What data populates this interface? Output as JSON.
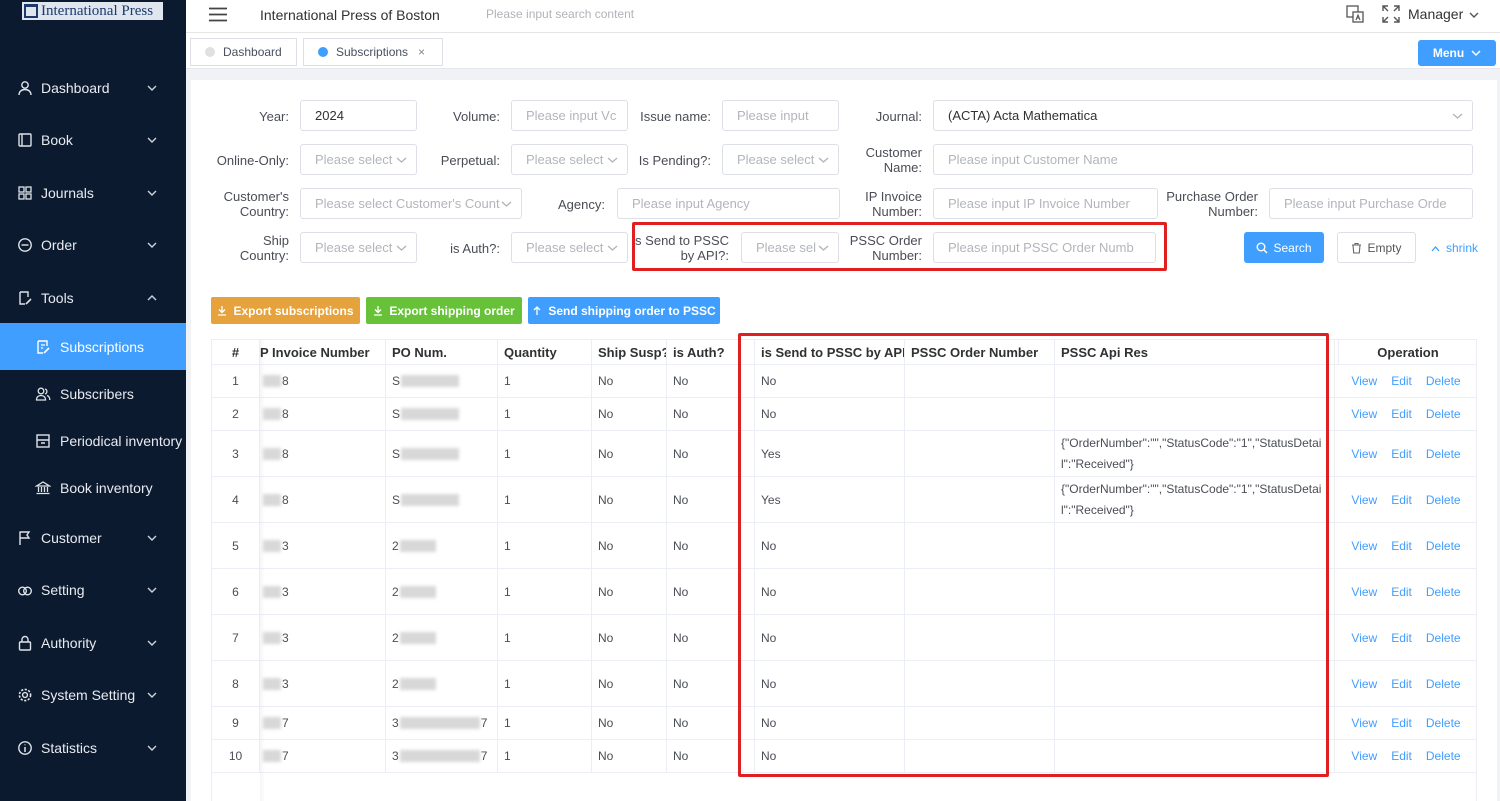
{
  "app": {
    "logo_text": "International Press",
    "header_title": "International Press of Boston",
    "search_placeholder": "Please input search content",
    "user_label": "Manager"
  },
  "sidebar": {
    "items": [
      {
        "label": "Dashboard",
        "icon": "user-icon"
      },
      {
        "label": "Book",
        "icon": "book-icon"
      },
      {
        "label": "Journals",
        "icon": "grid-icon"
      },
      {
        "label": "Order",
        "icon": "order-icon"
      },
      {
        "label": "Tools",
        "icon": "edit-icon"
      },
      {
        "label": "Customer",
        "icon": "flag-icon"
      },
      {
        "label": "Setting",
        "icon": "link-icon"
      },
      {
        "label": "Authority",
        "icon": "lock-icon"
      },
      {
        "label": "System Setting",
        "icon": "gear-icon"
      },
      {
        "label": "Statistics",
        "icon": "info-icon"
      }
    ],
    "tools_sub": [
      {
        "label": "Subscriptions",
        "icon": "edit-doc-icon"
      },
      {
        "label": "Subscribers",
        "icon": "users-icon"
      },
      {
        "label": "Periodical inventory",
        "icon": "inventory-icon"
      },
      {
        "label": "Book inventory",
        "icon": "bank-icon"
      }
    ]
  },
  "tabs": [
    {
      "label": "Dashboard",
      "dot_color": "#e0e0e0"
    },
    {
      "label": "Subscriptions",
      "dot_color": "#409eff",
      "close": "×"
    }
  ],
  "menu_button": "Menu",
  "filters": {
    "year": {
      "label": "Year:",
      "value": "2024"
    },
    "volume": {
      "label": "Volume:",
      "placeholder": "Please input Vc"
    },
    "issue_name": {
      "label": "Issue name:",
      "placeholder": "Please input"
    },
    "journal": {
      "label": "Journal:",
      "value": "(ACTA) Acta Mathematica"
    },
    "online_only": {
      "label": "Online-Only:",
      "placeholder": "Please select"
    },
    "perpetual": {
      "label": "Perpetual:",
      "placeholder": "Please select"
    },
    "is_pending": {
      "label": "Is Pending?:",
      "placeholder": "Please select"
    },
    "customer_name": {
      "label_line1": "Customer",
      "label_line2": "Name:",
      "placeholder": "Please input Customer Name"
    },
    "customers_country": {
      "label_line1": "Customer's",
      "label_line2": "Country:",
      "placeholder": "Please select Customer's Count"
    },
    "agency": {
      "label": "Agency:",
      "placeholder": "Please input Agency"
    },
    "ip_invoice": {
      "label_line1": "IP Invoice",
      "label_line2": "Number:",
      "placeholder": "Please input IP Invoice Number"
    },
    "purchase_order": {
      "label_line1": "Purchase Order",
      "label_line2": "Number:",
      "placeholder": "Please input Purchase Orde"
    },
    "ship_country": {
      "label_line1": "Ship",
      "label_line2": "Country:",
      "placeholder": "Please select"
    },
    "is_auth": {
      "label": "is Auth?:",
      "placeholder": "Please select"
    },
    "is_send_pssc": {
      "label_line1": "is Send to PSSC",
      "label_line2": "by API?:",
      "placeholder": "Please sel"
    },
    "pssc_order": {
      "label_line1": "PSSC Order",
      "label_line2": "Number:",
      "placeholder": "Please input PSSC Order Numb"
    }
  },
  "buttons": {
    "search": "Search",
    "empty": "Empty",
    "shrink": "shrink",
    "export_subscriptions": "Export subscriptions",
    "export_shipping": "Export shipping order",
    "send_shipping": "Send shipping order to PSSC"
  },
  "colors": {
    "accent": "#409eff",
    "export_orange": "#e6a23c",
    "export_green": "#67c23a",
    "sidebar_bg": "#0b1a2e",
    "highlight_red": "#e02020"
  },
  "table": {
    "columns": [
      "#",
      "P Invoice Number",
      "PO Num.",
      "Quantity",
      "Ship Susp?",
      "is Auth?",
      "is Send to PSSC by API?",
      "PSSC Order Number",
      "PSSC Api Res",
      "Operation"
    ],
    "operations": [
      "View",
      "Edit",
      "Delete"
    ],
    "rows": [
      {
        "n": "1",
        "inv_tail": "8",
        "po_head": "S",
        "po_tail": "",
        "qty": "1",
        "ship": "No",
        "auth": "No",
        "send": "No",
        "pssc_no": "",
        "api_res": ""
      },
      {
        "n": "2",
        "inv_tail": "8",
        "po_head": "S",
        "po_tail": "",
        "qty": "1",
        "ship": "No",
        "auth": "No",
        "send": "No",
        "pssc_no": "",
        "api_res": ""
      },
      {
        "n": "3",
        "inv_tail": "8",
        "po_head": "S",
        "po_tail": "",
        "qty": "1",
        "ship": "No",
        "auth": "No",
        "send": "Yes",
        "pssc_no": "",
        "api_res": "{\"OrderNumber\":\"\",\"StatusCode\":\"1\",\"StatusDetail\":\"Received\"}"
      },
      {
        "n": "4",
        "inv_tail": "8",
        "po_head": "S",
        "po_tail": "",
        "qty": "1",
        "ship": "No",
        "auth": "No",
        "send": "Yes",
        "pssc_no": "",
        "api_res": "{\"OrderNumber\":\"\",\"StatusCode\":\"1\",\"StatusDetail\":\"Received\"}"
      },
      {
        "n": "5",
        "inv_tail": "3",
        "po_head": "2",
        "po_tail": "",
        "qty": "1",
        "ship": "No",
        "auth": "No",
        "send": "No",
        "pssc_no": "",
        "api_res": ""
      },
      {
        "n": "6",
        "inv_tail": "3",
        "po_head": "2",
        "po_tail": "",
        "qty": "1",
        "ship": "No",
        "auth": "No",
        "send": "No",
        "pssc_no": "",
        "api_res": ""
      },
      {
        "n": "7",
        "inv_tail": "3",
        "po_head": "2",
        "po_tail": "",
        "qty": "1",
        "ship": "No",
        "auth": "No",
        "send": "No",
        "pssc_no": "",
        "api_res": ""
      },
      {
        "n": "8",
        "inv_tail": "3",
        "po_head": "2",
        "po_tail": "",
        "qty": "1",
        "ship": "No",
        "auth": "No",
        "send": "No",
        "pssc_no": "",
        "api_res": ""
      },
      {
        "n": "9",
        "inv_tail": "7",
        "po_head": "3",
        "po_tail": "7",
        "qty": "1",
        "ship": "No",
        "auth": "No",
        "send": "No",
        "pssc_no": "",
        "api_res": ""
      },
      {
        "n": "10",
        "inv_tail": "7",
        "po_head": "3",
        "po_tail": "7",
        "qty": "1",
        "ship": "No",
        "auth": "No",
        "send": "No",
        "pssc_no": "",
        "api_res": ""
      }
    ]
  }
}
